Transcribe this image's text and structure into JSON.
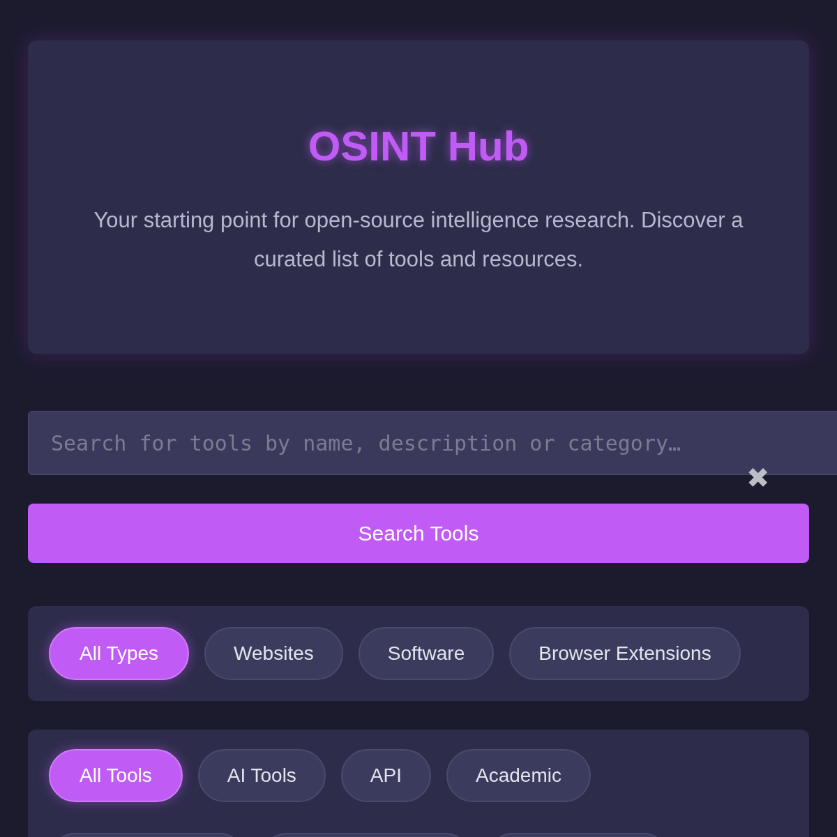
{
  "header": {
    "title": "OSINT Hub",
    "subtitle": "Your starting point for open-source intelligence research. Discover a curated list of tools and resources."
  },
  "search": {
    "placeholder": "Search for tools by name, description or category…",
    "clear_icon": "✖",
    "button": "Search Tools"
  },
  "type_filters": [
    {
      "label": "All Types",
      "selected": true
    },
    {
      "label": "Websites",
      "selected": false
    },
    {
      "label": "Software",
      "selected": false
    },
    {
      "label": "Browser Extensions",
      "selected": false
    }
  ],
  "category_filters": [
    {
      "label": "All Tools",
      "selected": true
    },
    {
      "label": "AI Tools",
      "selected": false
    },
    {
      "label": "API",
      "selected": false
    },
    {
      "label": "Academic",
      "selected": false
    }
  ]
}
